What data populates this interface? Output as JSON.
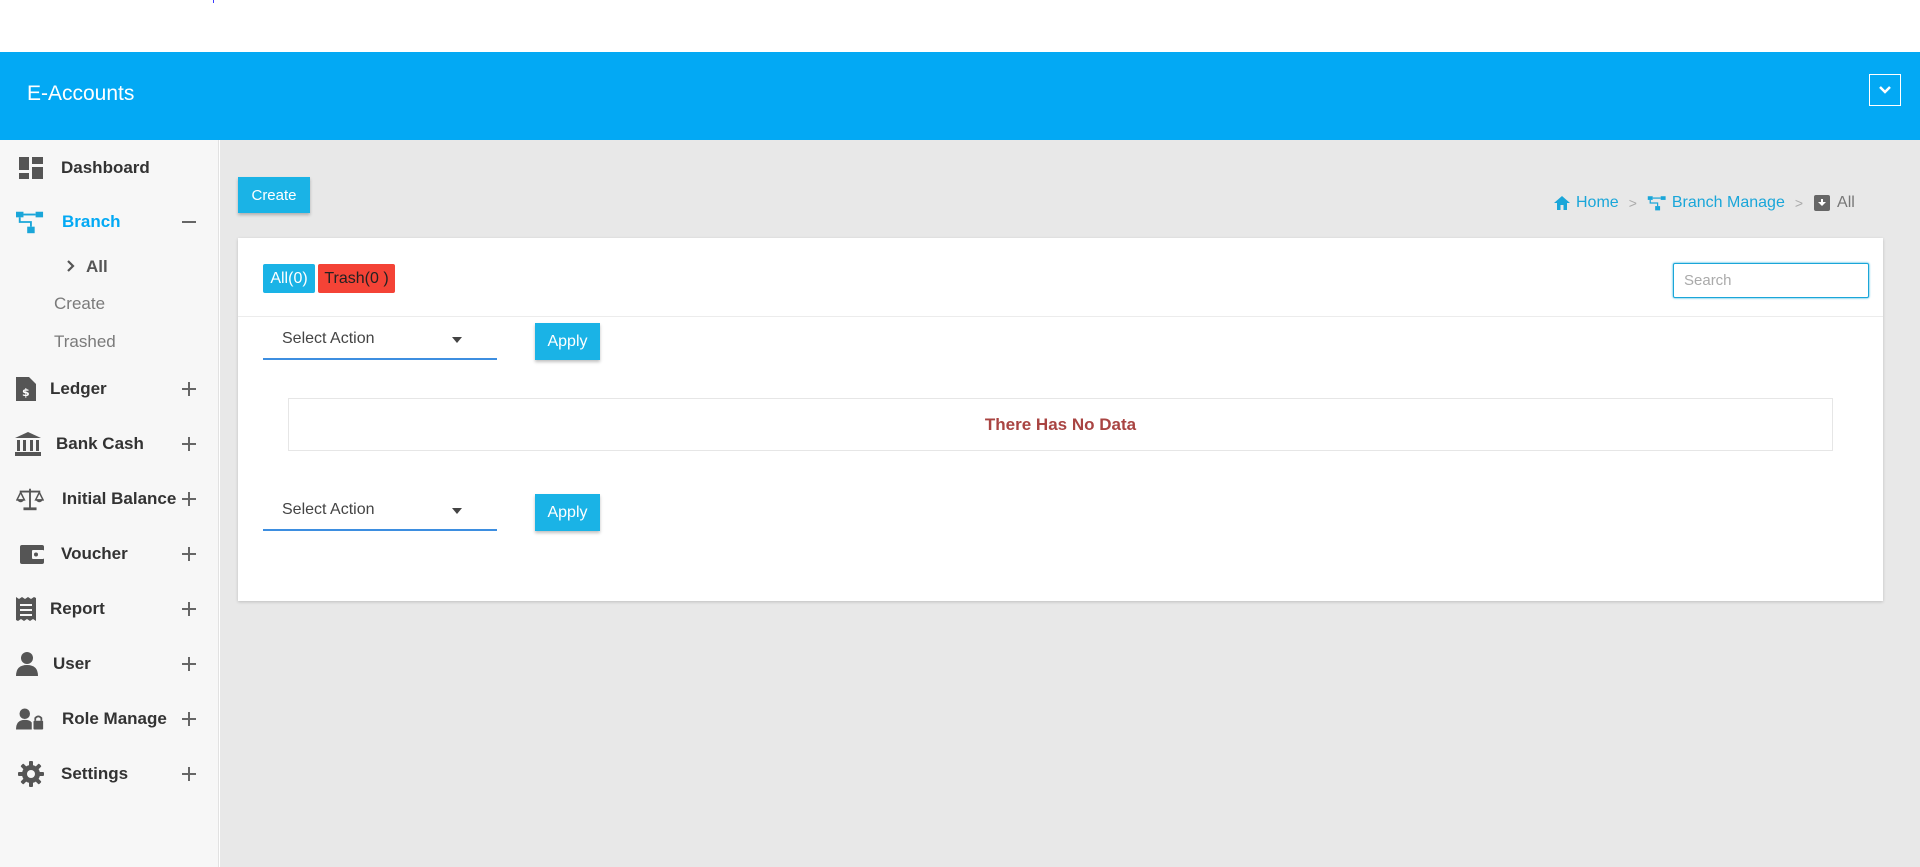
{
  "app": {
    "brand": "E-Accounts"
  },
  "sidebar": {
    "items": [
      {
        "label": "Dashboard",
        "icon": "dashboard-icon"
      },
      {
        "label": "Branch",
        "icon": "branch-icon",
        "expanded": true,
        "sub": [
          {
            "label": "All",
            "active": true
          },
          {
            "label": "Create"
          },
          {
            "label": "Trashed"
          }
        ]
      },
      {
        "label": "Ledger",
        "icon": "ledger-icon"
      },
      {
        "label": "Bank Cash",
        "icon": "bank-icon"
      },
      {
        "label": "Initial Balance",
        "icon": "balance-scale-icon"
      },
      {
        "label": "Voucher",
        "icon": "wallet-icon"
      },
      {
        "label": "Report",
        "icon": "report-icon"
      },
      {
        "label": "User",
        "icon": "user-icon"
      },
      {
        "label": "Role Manage",
        "icon": "user-lock-icon"
      },
      {
        "label": "Settings",
        "icon": "gear-icon"
      }
    ]
  },
  "toolbar": {
    "create_label": "Create"
  },
  "breadcrumb": {
    "home": "Home",
    "section": "Branch Manage",
    "current": "All",
    "separator": ">"
  },
  "card": {
    "all_tag": "All(0)",
    "trash_tag": "Trash(0 )",
    "search_placeholder": "Search",
    "select_action": "Select Action",
    "apply_label": "Apply",
    "no_data": "There Has No Data"
  },
  "colors": {
    "primary": "#03a9f4",
    "button": "#1ab3e6",
    "danger": "#f44336",
    "no_data_text": "#a94442"
  }
}
